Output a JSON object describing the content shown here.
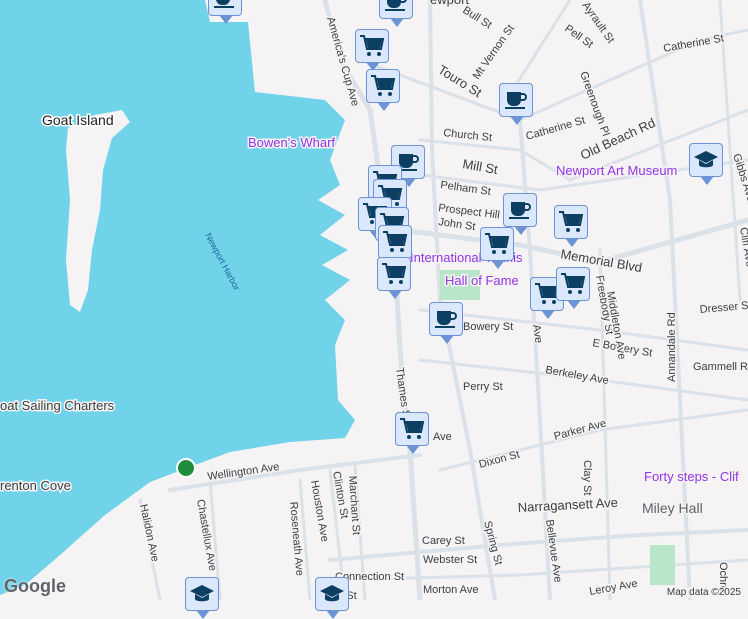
{
  "map": {
    "logo": "Google",
    "attribution": "Map data ©2025",
    "colors": {
      "water": "#70d3ea",
      "land": "#f5f3f3",
      "road": "#dbe1e8",
      "poi": "#9334e6",
      "marker_bg": "#dbe7fb",
      "marker_icon": "#0d3f63"
    },
    "places": {
      "goat_island": "Goat Island",
      "bowens_wharf": "Bowen's Wharf",
      "newport_harbor": "Newport Harbor",
      "art_museum": "Newport Art Museum",
      "tennis_1": "International Tennis",
      "tennis_2": "Hall of Fame",
      "forty_steps": "Forty steps - Clif",
      "miley_hall": "Miley Hall",
      "sailing": "oat Sailing Charters",
      "brenton_cove": "renton Cove",
      "newport": "ewport"
    },
    "streets": {
      "americas_cup": "America's Cup Ave",
      "thames": "Thames St",
      "bull": "Bull St",
      "touro": "Touro St",
      "mt_vernon": "Mt Vernon St",
      "pell": "Pell St",
      "ayrault": "Ayrault St",
      "catherine1": "Catherine St",
      "greenough": "Greenough Pl",
      "church": "Church St",
      "catherine2": "Catherine St",
      "old_beach": "Old Beach Rd",
      "mill": "Mill St",
      "pelham": "Pelham St",
      "prospect": "Prospect Hill St",
      "john": "John St",
      "memorial": "Memorial Blvd",
      "gibbs": "Gibbs Ave",
      "cliff": "Cliff Ave",
      "annandale": "Annandale Rd",
      "dresser": "Dresser St",
      "e_bowery": "E Bowery St",
      "bowery": "Bowery St",
      "gammell": "Gammell Rd",
      "berkeley": "Berkeley Ave",
      "perry": "Perry St",
      "parker": "Parker Ave",
      "dixon": "Dixon St",
      "clay": "Clay St",
      "bellevue": "Bellevue Ave",
      "spring": "Spring St",
      "narragansett": "Narragansett Ave",
      "carey": "Carey St",
      "webster": "Webster St",
      "connection": "Connection St",
      "morton": "Morton Ave",
      "atlantic": "antic St",
      "wellington": "Wellington Ave",
      "chastellux": "Chastellux Ave",
      "halidon": "Halidon Ave",
      "roseneath": "Roseneath Ave",
      "houston": "Houston Ave",
      "clinton": "Clinton St",
      "marchant": "Marchant St",
      "freebody": "Freebody St",
      "middleton": "Middleton Ave",
      "ochre": "Ochre",
      "leroy": "Leroy Ave",
      "ave": "Ave",
      "bellevue2": "Ave"
    },
    "markers": [
      "coffee",
      "coffee",
      "cart",
      "cart",
      "coffee",
      "coffee",
      "cart",
      "cart",
      "cart",
      "cart",
      "cart",
      "cart",
      "graduation-cap",
      "coffee",
      "cart",
      "cart",
      "cart",
      "cart",
      "coffee",
      "cart",
      "graduation-cap",
      "graduation-cap"
    ]
  }
}
